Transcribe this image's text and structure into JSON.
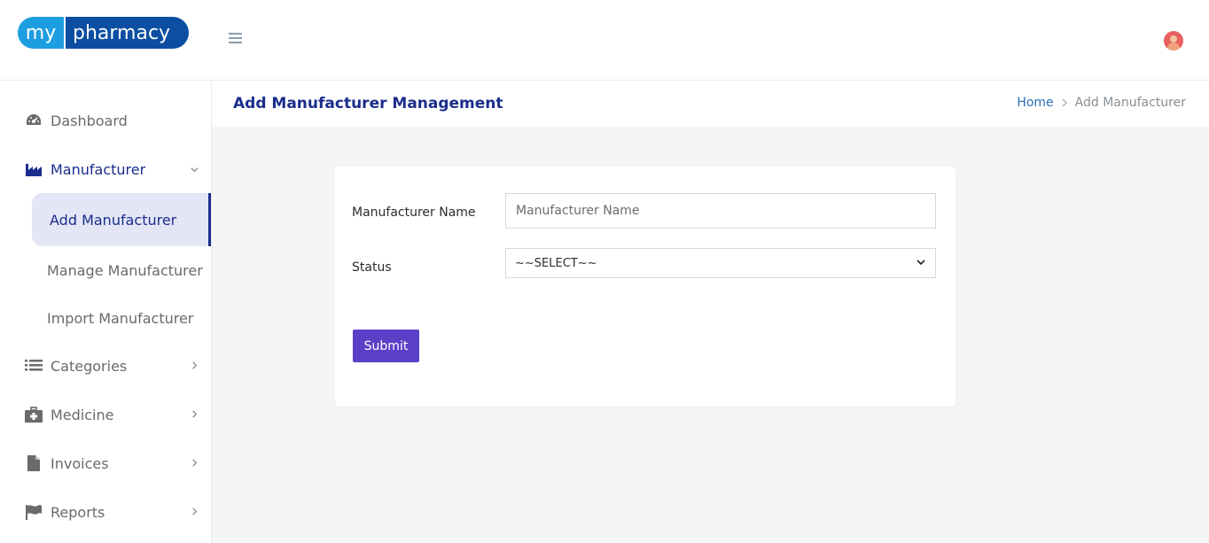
{
  "header": {
    "logo_my": "my",
    "logo_pharmacy": "pharmacy"
  },
  "sidebar": {
    "items": [
      {
        "label": "Dashboard",
        "icon": "dashboard-gauge-icon"
      },
      {
        "label": "Manufacturer",
        "icon": "factory-icon",
        "expanded": true
      },
      {
        "label": "Categories",
        "icon": "list-icon"
      },
      {
        "label": "Medicine",
        "icon": "medical-kit-icon"
      },
      {
        "label": "Invoices",
        "icon": "file-icon"
      },
      {
        "label": "Reports",
        "icon": "flag-icon"
      }
    ],
    "sub_items": [
      {
        "label": "Add Manufacturer",
        "active": true
      },
      {
        "label": "Manage Manufacturer"
      },
      {
        "label": "Import Manufacturer"
      }
    ]
  },
  "page": {
    "title": "Add Manufacturer Management",
    "breadcrumb_home": "Home",
    "breadcrumb_current": "Add Manufacturer"
  },
  "form": {
    "name_label": "Manufacturer Name",
    "name_placeholder": "Manufacturer Name",
    "status_label": "Status",
    "status_selected": "~~SELECT~~",
    "submit_label": "Submit"
  },
  "colors": {
    "accent": "#1a2d8c",
    "button": "#5b3fc7",
    "logo_light": "#1d9ee0",
    "logo_dark": "#0c4ea2"
  }
}
